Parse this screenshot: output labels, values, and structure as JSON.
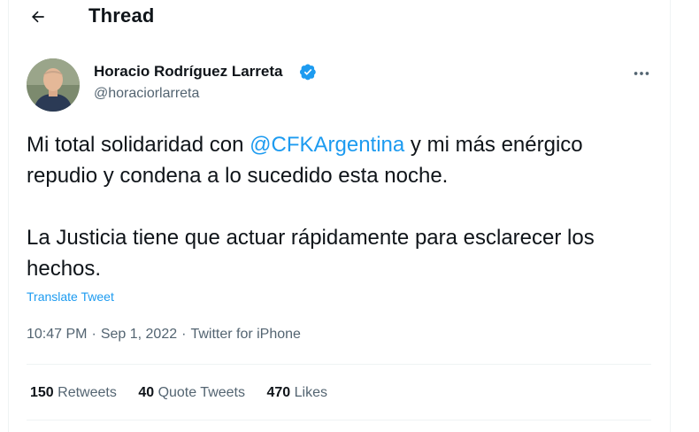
{
  "header": {
    "back_icon": "arrow-left-icon",
    "title": "Thread"
  },
  "tweet": {
    "author": {
      "name": "Horacio Rodríguez Larreta",
      "handle": "@horaciorlarreta",
      "verified_icon": "verified-badge-icon"
    },
    "more_icon": "more-horizontal-icon",
    "text_para1_before": "Mi total solidaridad con ",
    "mention": "@CFKArgentina",
    "text_para1_after": " y mi más enérgico repudio y condena a lo sucedido esta noche.",
    "text_para2": "La Justicia tiene que actuar rápidamente para esclarecer los hechos.",
    "translate_label": "Translate Tweet",
    "time": "10:47 PM",
    "separator": "·",
    "date": "Sep 1, 2022",
    "source": "Twitter for iPhone",
    "stats": {
      "retweets_count": "150",
      "retweets_label": "Retweets",
      "quotes_count": "40",
      "quotes_label": "Quote Tweets",
      "likes_count": "470",
      "likes_label": "Likes"
    }
  },
  "colors": {
    "accent": "#1d9bf0",
    "text": "#0f1419",
    "secondary": "#536471",
    "divider": "#eff3f4"
  }
}
